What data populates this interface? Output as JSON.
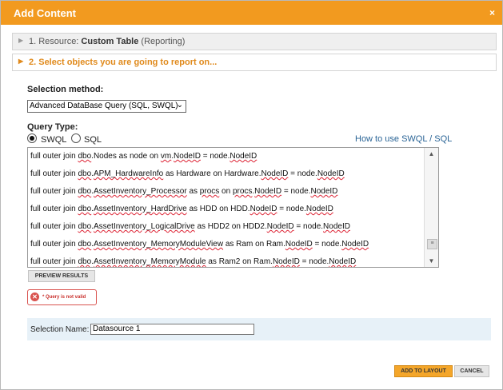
{
  "dialog": {
    "title": "Add Content",
    "close_glyph": "×"
  },
  "steps": {
    "step1_prefix": "1. Resource: ",
    "step1_name": "Custom Table",
    "step1_suffix": " (Reporting)",
    "step2_label": "2. Select objects you are going to report on..."
  },
  "selection": {
    "method_label": "Selection method:",
    "method_value": "Advanced DataBase Query (SQL, SWQL)"
  },
  "query_type": {
    "label": "Query Type:",
    "options": [
      "SWQL",
      "SQL"
    ],
    "selected": "SWQL",
    "help_link": "How to use SWQL / SQL"
  },
  "query_lines": [
    {
      "parts": [
        "full outer join ",
        {
          "u": "dbo"
        },
        ".Nodes as node on ",
        {
          "u": "vm"
        },
        ".",
        {
          "u": "NodeID"
        },
        " = node.",
        {
          "u": "NodeID"
        }
      ]
    },
    {
      "parts": [
        "full outer join ",
        {
          "u": "dbo"
        },
        ".",
        {
          "u": "APM_HardwareInfo"
        },
        " as Hardware on Hardware.",
        {
          "u": "NodeID"
        },
        " = node.",
        {
          "u": "NodeID"
        }
      ]
    },
    {
      "parts": [
        "full outer join ",
        {
          "u": "dbo"
        },
        ".",
        {
          "u": "AssetInventory_Processor"
        },
        " as ",
        {
          "u": "procs"
        },
        " on ",
        {
          "u": "procs"
        },
        ".",
        {
          "u": "NodeID"
        },
        " = node.",
        {
          "u": "NodeID"
        }
      ]
    },
    {
      "parts": [
        "full outer join ",
        {
          "u": "dbo"
        },
        ".",
        {
          "u": "AssetInventory_HardDrive"
        },
        " as HDD on HDD.",
        {
          "u": "NodeID"
        },
        " = node.",
        {
          "u": "NodeID"
        }
      ]
    },
    {
      "parts": [
        "full outer join ",
        {
          "u": "dbo"
        },
        ".",
        {
          "u": "AssetInventory_LogicalDrive"
        },
        " as HDD2 on HDD2.",
        {
          "u": "NodeID"
        },
        " = node.",
        {
          "u": "NodeID"
        }
      ]
    },
    {
      "parts": [
        "full outer join ",
        {
          "u": "dbo"
        },
        ".",
        {
          "u": "AssetInventory_MemoryModuleView"
        },
        " as Ram on Ram.",
        {
          "u": "NodeID"
        },
        " = node.",
        {
          "u": "NodeID"
        }
      ]
    },
    {
      "parts": [
        "full outer join ",
        {
          "u": "dbo"
        },
        ".",
        {
          "u": "AssetInventory_MemoryModule"
        },
        " as Ram2 on Ram.",
        {
          "u": "NodeID"
        },
        " = node.",
        {
          "u": "NodeID"
        }
      ]
    }
  ],
  "buttons": {
    "preview": "PREVIEW RESULTS",
    "add_to_layout": "ADD TO LAYOUT",
    "cancel": "CANCEL"
  },
  "error": {
    "icon": "x-icon",
    "message": "* Query is not valid"
  },
  "selection_name": {
    "label": "Selection Name:",
    "value": "Datasource 1"
  },
  "colors": {
    "titlebar": "#f29a1f",
    "step_active": "#e08a1c",
    "error": "#d9534f",
    "link": "#2a6496",
    "name_panel": "#e7f1f8"
  }
}
